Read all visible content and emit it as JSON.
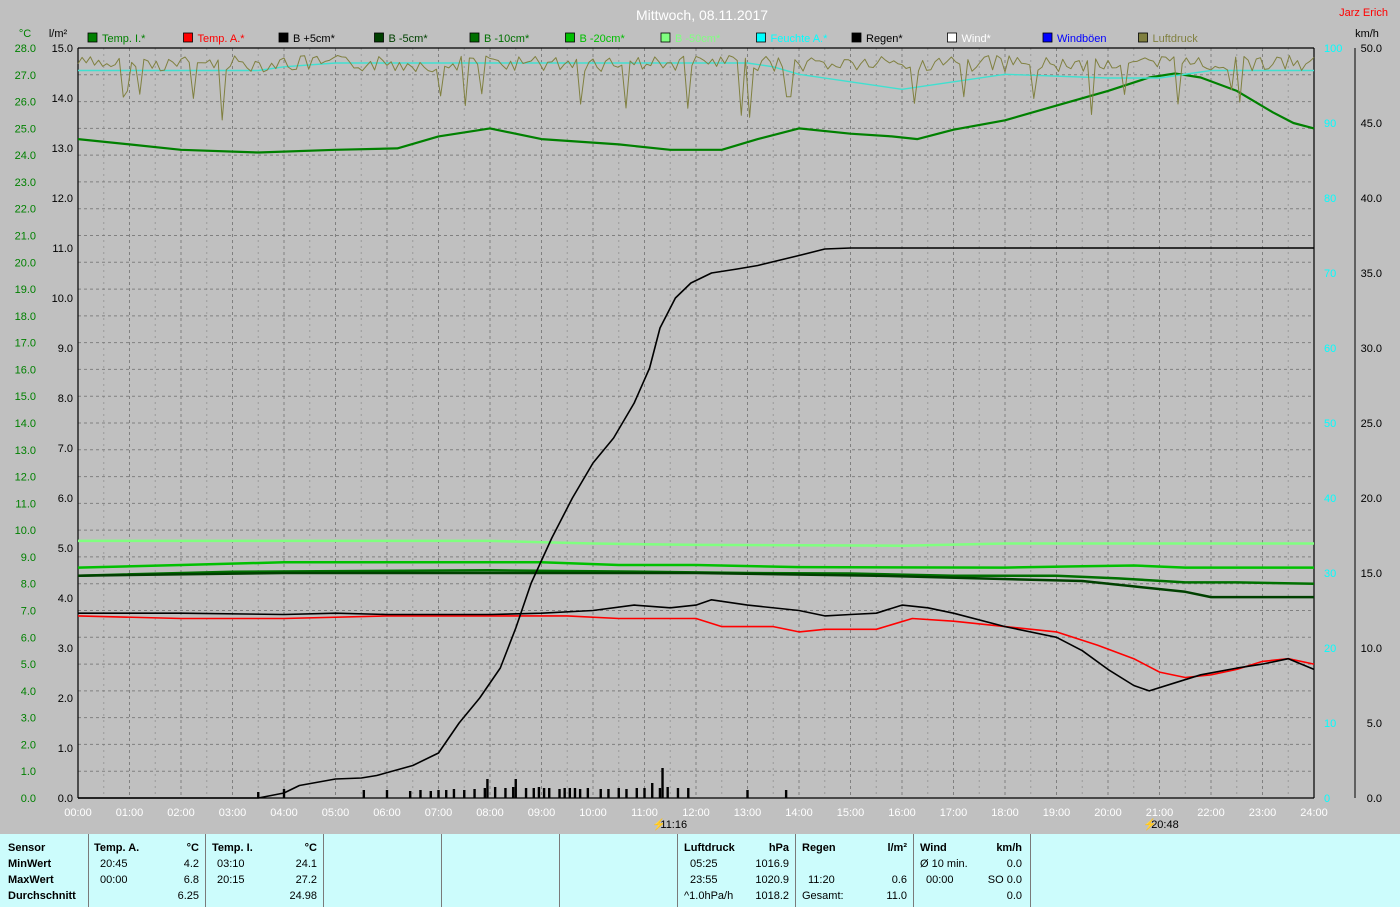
{
  "title": "Mittwoch, 08.11.2017",
  "author": "Jarz Erich",
  "units": {
    "temp": "°C",
    "rain": "l/m²",
    "wind": "km/h"
  },
  "legend": [
    {
      "label": "Temp. I.*",
      "color": "#008000"
    },
    {
      "label": "Temp. A.*",
      "color": "#ff0000"
    },
    {
      "label": "B +5cm*",
      "color": "#000000"
    },
    {
      "label": "B -5cm*",
      "color": "#004000"
    },
    {
      "label": "B -10cm*",
      "color": "#007000"
    },
    {
      "label": "B -20cm*",
      "color": "#00c000"
    },
    {
      "label": "B -50cm*",
      "color": "#80ff80"
    },
    {
      "label": "Feuchte A.*",
      "color": "#00ffff"
    },
    {
      "label": "Regen*",
      "color": "#000000"
    },
    {
      "label": "Wind*",
      "color": "#ffffff"
    },
    {
      "label": "Windböen",
      "color": "#0000ff"
    },
    {
      "label": "Luftdruck",
      "color": "#808040"
    }
  ],
  "markers": [
    {
      "label": "11:16"
    },
    {
      "label": "20:48"
    }
  ],
  "chart_data": {
    "type": "line",
    "title": "Mittwoch, 08.11.2017",
    "x_ticks": [
      "00:00",
      "01:00",
      "02:00",
      "03:00",
      "04:00",
      "05:00",
      "06:00",
      "07:00",
      "08:00",
      "09:00",
      "10:00",
      "11:00",
      "12:00",
      "13:00",
      "14:00",
      "15:00",
      "16:00",
      "17:00",
      "18:00",
      "19:00",
      "20:00",
      "21:00",
      "22:00",
      "23:00",
      "24:00"
    ],
    "xlim": [
      0,
      24
    ],
    "axes": {
      "temp": {
        "label": "°C",
        "ylim": [
          0,
          28
        ],
        "ticks": [
          "0.0",
          "1.0",
          "2.0",
          "3.0",
          "4.0",
          "5.0",
          "6.0",
          "7.0",
          "8.0",
          "9.0",
          "10.0",
          "11.0",
          "12.0",
          "13.0",
          "14.0",
          "15.0",
          "16.0",
          "17.0",
          "18.0",
          "19.0",
          "20.0",
          "21.0",
          "22.0",
          "23.0",
          "24.0",
          "25.0",
          "26.0",
          "27.0",
          "28.0"
        ]
      },
      "rain": {
        "label": "l/m²",
        "ylim": [
          0,
          15
        ],
        "ticks": [
          "0.0",
          "1.0",
          "2.0",
          "3.0",
          "4.0",
          "5.0",
          "6.0",
          "7.0",
          "8.0",
          "9.0",
          "10.0",
          "11.0",
          "12.0",
          "13.0",
          "14.0",
          "15.0"
        ]
      },
      "humidity": {
        "label": "%",
        "ylim": [
          0,
          100
        ],
        "ticks": [
          "0",
          "10",
          "20",
          "30",
          "40",
          "50",
          "60",
          "70",
          "80",
          "90",
          "100"
        ]
      },
      "wind": {
        "label": "km/h",
        "ylim": [
          0,
          50
        ],
        "ticks": [
          "0.0",
          "5.0",
          "10.0",
          "15.0",
          "20.0",
          "25.0",
          "30.0",
          "35.0",
          "40.0",
          "45.0",
          "50.0"
        ]
      }
    },
    "grid": true,
    "legend_position": "top",
    "series": [
      {
        "name": "Temp. I.*",
        "axis": "temp",
        "color": "#008000",
        "width": 2.2,
        "points": [
          [
            0,
            24.6
          ],
          [
            1,
            24.4
          ],
          [
            2,
            24.2
          ],
          [
            3.5,
            24.1
          ],
          [
            5,
            24.2
          ],
          [
            6.2,
            24.25
          ],
          [
            7,
            24.7
          ],
          [
            8,
            25.0
          ],
          [
            9,
            24.6
          ],
          [
            10.5,
            24.4
          ],
          [
            11.5,
            24.2
          ],
          [
            12.5,
            24.2
          ],
          [
            13.2,
            24.6
          ],
          [
            14,
            25.0
          ],
          [
            15,
            24.8
          ],
          [
            15.8,
            24.7
          ],
          [
            16.3,
            24.6
          ],
          [
            17,
            24.95
          ],
          [
            18,
            25.3
          ],
          [
            19,
            25.85
          ],
          [
            20,
            26.4
          ],
          [
            20.8,
            26.9
          ],
          [
            21.3,
            27.05
          ],
          [
            21.8,
            26.9
          ],
          [
            22.5,
            26.4
          ],
          [
            23.2,
            25.6
          ],
          [
            23.6,
            25.2
          ],
          [
            24,
            25.0
          ]
        ]
      },
      {
        "name": "B -50cm*",
        "axis": "temp",
        "color": "#80ff80",
        "width": 2.5,
        "points": [
          [
            0,
            9.6
          ],
          [
            8,
            9.6
          ],
          [
            10,
            9.5
          ],
          [
            12,
            9.45
          ],
          [
            16,
            9.42
          ],
          [
            18,
            9.5
          ],
          [
            24,
            9.5
          ]
        ]
      },
      {
        "name": "B -20cm*",
        "axis": "temp",
        "color": "#00c000",
        "width": 2.5,
        "points": [
          [
            0,
            8.6
          ],
          [
            2,
            8.7
          ],
          [
            4,
            8.8
          ],
          [
            9,
            8.8
          ],
          [
            10.5,
            8.7
          ],
          [
            12,
            8.7
          ],
          [
            14,
            8.62
          ],
          [
            18,
            8.6
          ],
          [
            19.5,
            8.65
          ],
          [
            20.5,
            8.68
          ],
          [
            21.5,
            8.6
          ],
          [
            22.5,
            8.6
          ],
          [
            24,
            8.6
          ]
        ]
      },
      {
        "name": "B -10cm*",
        "axis": "temp",
        "color": "#007000",
        "width": 2.5,
        "points": [
          [
            0,
            8.3
          ],
          [
            3,
            8.45
          ],
          [
            8,
            8.5
          ],
          [
            11,
            8.45
          ],
          [
            13,
            8.4
          ],
          [
            15,
            8.38
          ],
          [
            17,
            8.3
          ],
          [
            19,
            8.3
          ],
          [
            20.2,
            8.2
          ],
          [
            21.5,
            8.05
          ],
          [
            22.5,
            8.05
          ],
          [
            24,
            8.0
          ]
        ]
      },
      {
        "name": "B -5cm*",
        "axis": "temp",
        "color": "#004000",
        "width": 2.5,
        "points": [
          [
            0,
            8.3
          ],
          [
            4,
            8.4
          ],
          [
            8,
            8.4
          ],
          [
            12,
            8.4
          ],
          [
            15.5,
            8.3
          ],
          [
            17.5,
            8.2
          ],
          [
            19.5,
            8.1
          ],
          [
            20.5,
            7.9
          ],
          [
            21.5,
            7.7
          ],
          [
            22,
            7.5
          ],
          [
            24,
            7.5
          ]
        ]
      },
      {
        "name": "Temp. A.*",
        "axis": "temp",
        "color": "#ff0000",
        "width": 1.6,
        "points": [
          [
            0,
            6.8
          ],
          [
            2,
            6.7
          ],
          [
            4,
            6.7
          ],
          [
            6,
            6.8
          ],
          [
            8,
            6.8
          ],
          [
            9.5,
            6.8
          ],
          [
            10.5,
            6.7
          ],
          [
            12,
            6.7
          ],
          [
            12.5,
            6.4
          ],
          [
            13.5,
            6.4
          ],
          [
            14,
            6.2
          ],
          [
            14.5,
            6.3
          ],
          [
            15.5,
            6.3
          ],
          [
            16.2,
            6.7
          ],
          [
            17,
            6.6
          ],
          [
            18,
            6.4
          ],
          [
            19,
            6.2
          ],
          [
            19.8,
            5.7
          ],
          [
            20.5,
            5.2
          ],
          [
            21,
            4.7
          ],
          [
            21.5,
            4.5
          ],
          [
            22,
            4.6
          ],
          [
            22.5,
            4.8
          ],
          [
            23,
            5.1
          ],
          [
            23.5,
            5.2
          ],
          [
            24,
            5.0
          ]
        ]
      },
      {
        "name": "B +5cm*",
        "axis": "temp",
        "color": "#000000",
        "width": 1.6,
        "points": [
          [
            0,
            6.9
          ],
          [
            2,
            6.9
          ],
          [
            4,
            6.85
          ],
          [
            5,
            6.9
          ],
          [
            6,
            6.85
          ],
          [
            8,
            6.85
          ],
          [
            9,
            6.9
          ],
          [
            10,
            7.0
          ],
          [
            10.8,
            7.2
          ],
          [
            11.5,
            7.1
          ],
          [
            12,
            7.2
          ],
          [
            12.3,
            7.4
          ],
          [
            13,
            7.2
          ],
          [
            14,
            7.0
          ],
          [
            14.5,
            6.8
          ],
          [
            15,
            6.85
          ],
          [
            15.5,
            6.9
          ],
          [
            16,
            7.2
          ],
          [
            16.5,
            7.1
          ],
          [
            17,
            6.9
          ],
          [
            18,
            6.4
          ],
          [
            19,
            6.0
          ],
          [
            19.5,
            5.5
          ],
          [
            20,
            4.8
          ],
          [
            20.5,
            4.2
          ],
          [
            20.8,
            4.0
          ],
          [
            21.3,
            4.3
          ],
          [
            21.8,
            4.6
          ],
          [
            22.5,
            4.85
          ],
          [
            23,
            5.0
          ],
          [
            23.5,
            5.2
          ],
          [
            24,
            4.8
          ]
        ]
      },
      {
        "name": "Regen*",
        "axis": "rain",
        "color": "#000000",
        "width": 1.6,
        "points": [
          [
            0,
            0
          ],
          [
            3.5,
            0
          ],
          [
            4,
            0.1
          ],
          [
            4.3,
            0.25
          ],
          [
            5,
            0.38
          ],
          [
            5.5,
            0.4
          ],
          [
            5.8,
            0.45
          ],
          [
            6.5,
            0.65
          ],
          [
            7,
            0.9
          ],
          [
            7.4,
            1.5
          ],
          [
            7.8,
            2.0
          ],
          [
            8.2,
            2.6
          ],
          [
            8.5,
            3.4
          ],
          [
            8.8,
            4.3
          ],
          [
            9.2,
            5.2
          ],
          [
            9.6,
            6.0
          ],
          [
            10,
            6.7
          ],
          [
            10.4,
            7.2
          ],
          [
            10.8,
            7.9
          ],
          [
            11.1,
            8.6
          ],
          [
            11.3,
            9.4
          ],
          [
            11.6,
            10.0
          ],
          [
            11.9,
            10.3
          ],
          [
            12.3,
            10.5
          ],
          [
            12.8,
            10.58
          ],
          [
            13.2,
            10.65
          ],
          [
            14,
            10.85
          ],
          [
            14.5,
            10.98
          ],
          [
            15,
            11.0
          ],
          [
            24,
            11.0
          ]
        ]
      },
      {
        "name": "Feuchte A.*",
        "axis": "humidity",
        "color": "#40e0d0",
        "width": 1.4,
        "points": [
          [
            0,
            97
          ],
          [
            3.5,
            97
          ],
          [
            4,
            97.5
          ],
          [
            5,
            98
          ],
          [
            8,
            98
          ],
          [
            13,
            98
          ],
          [
            13.5,
            97.5
          ],
          [
            14,
            96.5
          ],
          [
            15,
            95.5
          ],
          [
            16,
            94.5
          ],
          [
            17,
            95.5
          ],
          [
            18,
            96.5
          ],
          [
            20,
            96
          ],
          [
            21,
            96
          ],
          [
            22,
            97
          ],
          [
            24,
            97
          ]
        ]
      },
      {
        "name": "Luftdruck",
        "axis": "humidity",
        "color": "#808040",
        "width": 1.0,
        "spiky": true,
        "points": [
          [
            0,
            99
          ],
          [
            24,
            99
          ]
        ]
      }
    ],
    "rain_bars": [
      [
        3.5,
        0.12
      ],
      [
        4.0,
        0.18
      ],
      [
        5.55,
        0.16
      ],
      [
        6.0,
        0.16
      ],
      [
        6.45,
        0.14
      ],
      [
        6.65,
        0.16
      ],
      [
        6.85,
        0.14
      ],
      [
        7.0,
        0.16
      ],
      [
        7.15,
        0.16
      ],
      [
        7.3,
        0.18
      ],
      [
        7.5,
        0.16
      ],
      [
        7.7,
        0.18
      ],
      [
        7.9,
        0.2
      ],
      [
        7.95,
        0.38
      ],
      [
        8.1,
        0.22
      ],
      [
        8.3,
        0.2
      ],
      [
        8.45,
        0.22
      ],
      [
        8.5,
        0.38
      ],
      [
        8.7,
        0.2
      ],
      [
        8.85,
        0.2
      ],
      [
        8.95,
        0.22
      ],
      [
        9.05,
        0.2
      ],
      [
        9.15,
        0.2
      ],
      [
        9.35,
        0.18
      ],
      [
        9.45,
        0.2
      ],
      [
        9.55,
        0.2
      ],
      [
        9.65,
        0.2
      ],
      [
        9.75,
        0.18
      ],
      [
        9.9,
        0.2
      ],
      [
        10.15,
        0.18
      ],
      [
        10.3,
        0.18
      ],
      [
        10.5,
        0.2
      ],
      [
        10.65,
        0.18
      ],
      [
        10.85,
        0.2
      ],
      [
        11.0,
        0.2
      ],
      [
        11.15,
        0.3
      ],
      [
        11.3,
        0.2
      ],
      [
        11.35,
        0.6
      ],
      [
        11.45,
        0.22
      ],
      [
        11.65,
        0.2
      ],
      [
        11.85,
        0.2
      ],
      [
        13.0,
        0.16
      ],
      [
        13.75,
        0.16
      ]
    ]
  },
  "stats": {
    "sensor": {
      "header": "Sensor",
      "rows": [
        "MinWert",
        "MaxWert",
        "Durchschnitt"
      ]
    },
    "temp_a": {
      "header": "Temp. A.",
      "unit": "°C",
      "min_time": "20:45",
      "min_val": "4.2",
      "max_time": "00:00",
      "max_val": "6.8",
      "avg": "6.25"
    },
    "temp_i": {
      "header": "Temp. I.",
      "unit": "°C",
      "min_time": "03:10",
      "min_val": "24.1",
      "max_time": "20:15",
      "max_val": "27.2",
      "avg": "24.98"
    },
    "pressure": {
      "header": "Luftdruck",
      "unit": "hPa",
      "min_time": "05:25",
      "min_val": "1016.9",
      "max_time": "23:55",
      "max_val": "1020.9",
      "trend": "^1.0hPa/h",
      "avg": "1018.2"
    },
    "rain": {
      "header": "Regen",
      "unit": "l/m²",
      "max_time": "11:20",
      "max_val": "0.6",
      "total_label": "Gesamt:",
      "total": "11.0"
    },
    "wind": {
      "header": "Wind",
      "unit": "km/h",
      "avg_label": "Ø 10 min.",
      "avg_val": "0.0",
      "max_time": "00:00",
      "max_val": "SO 0.0",
      "total": "0.0"
    }
  }
}
